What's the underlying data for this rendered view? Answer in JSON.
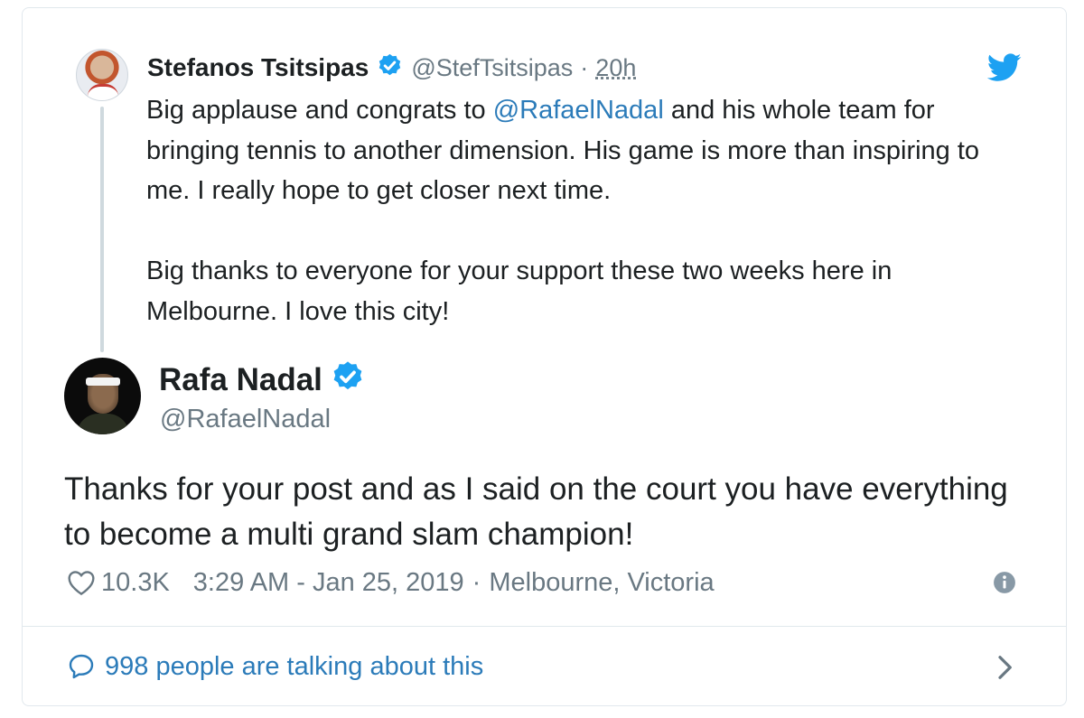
{
  "parent_tweet": {
    "author_name": "Stefanos Tsitsipas",
    "handle": "@StefTsitsipas",
    "separator": "·",
    "time": "20h",
    "text_before_mention": "Big applause and congrats to ",
    "mention": "@RafaelNadal",
    "text_after_mention": " and his whole team for bringing tennis to another dimension. His game is more than inspiring to me. I really hope to get closer next time.",
    "second_paragraph": "Big thanks to everyone for your support these two weeks here in Melbourne. I love this city!"
  },
  "main_tweet": {
    "author_name": "Rafa Nadal",
    "handle": "@RafaelNadal",
    "text": "Thanks for your post and as I said on the court you have everything to become a multi grand slam champion!",
    "like_count": "10.3K",
    "timestamp": "3:29 AM - Jan 25, 2019",
    "separator": "·",
    "location": "Melbourne, Victoria"
  },
  "footer": {
    "talking_label": "998 people are talking about this"
  },
  "icons": {
    "verified": "verified-badge-icon",
    "brand": "twitter-bird-icon",
    "like": "heart-icon",
    "info": "info-icon",
    "reply": "speech-bubble-icon",
    "chevron": "chevron-right-icon"
  },
  "colors": {
    "link": "#2b7bb9",
    "verified": "#1da1f2",
    "muted": "#697882",
    "text": "#1c2022",
    "border": "#e1e8ed"
  }
}
